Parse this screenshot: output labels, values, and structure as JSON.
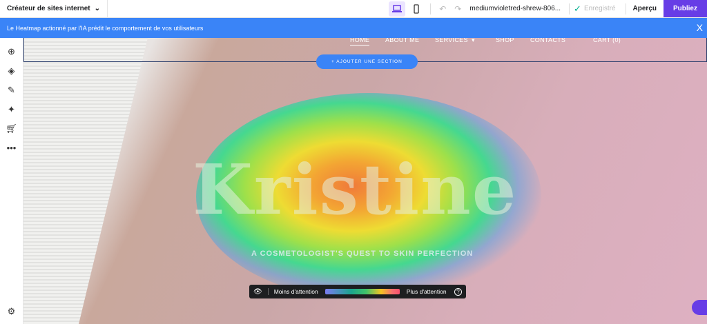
{
  "topbar": {
    "brand": "Créateur de sites internet",
    "domain": "mediumvioletred-shrew-806...",
    "saved": "Enregistré",
    "preview": "Aperçu",
    "publish": "Publiez"
  },
  "banner": {
    "text": "Le Heatmap actionné par l'IA prédit le comportement de vos utilisateurs",
    "close": "X"
  },
  "nav": {
    "items": [
      "HOME",
      "ABOUT ME",
      "SERVICES",
      "SHOP",
      "CONTACTS",
      "CART (0)"
    ]
  },
  "add_section": "+ AJOUTER UNE SECTION",
  "hero": {
    "title": "Kristine",
    "subtitle": "A COSMETOLOGIST'S QUEST TO SKIN PERFECTION"
  },
  "legend": {
    "less": "Moins d'attention",
    "more": "Plus d'attention",
    "help": "?"
  }
}
